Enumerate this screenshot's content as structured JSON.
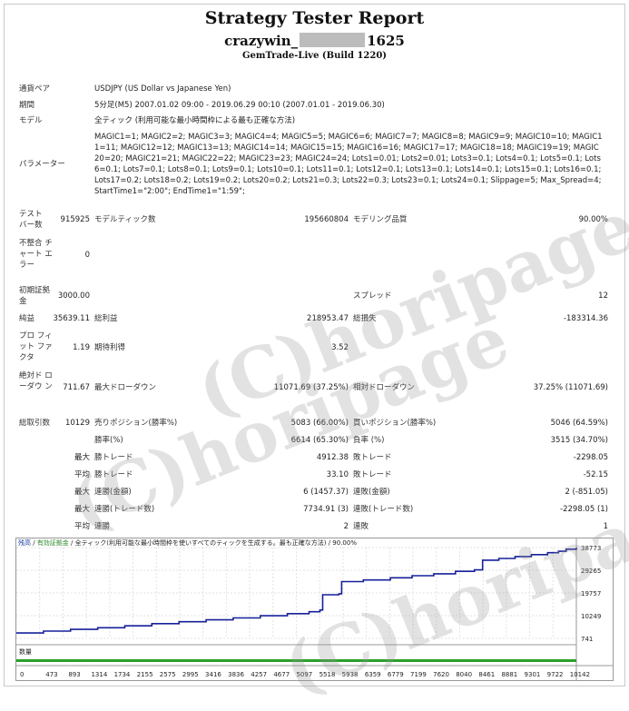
{
  "title": "Strategy Tester Report",
  "name_prefix": "crazywin_",
  "name_suffix": "1625",
  "build": "GemTrade-Live (Build 1220)",
  "rows": {
    "pair_label": "通貨ペア",
    "pair_value": "USDJPY (US Dollar vs Japanese Yen)",
    "period_label": "期間",
    "period_value": "5分足(M5) 2007.01.02 09:00 - 2019.06.29 00:10 (2007.01.01 - 2019.06.30)",
    "model_label": "モデル",
    "model_value": "全ティック (利用可能な最小時間枠による最も正確な方法)",
    "params_label": "パラメーター",
    "params_value": "MAGIC1=1; MAGIC2=2; MAGIC3=3; MAGIC4=4; MAGIC5=5; MAGIC6=6; MAGIC7=7; MAGIC8=8; MAGIC9=9; MAGIC10=10; MAGIC11=11; MAGIC12=12; MAGIC13=13; MAGIC14=14; MAGIC15=15; MAGIC16=16; MAGIC17=17; MAGIC18=18; MAGIC19=19; MAGIC20=20; MAGIC21=21; MAGIC22=22; MAGIC23=23; MAGIC24=24; Lots1=0.01; Lots2=0.01; Lots3=0.1; Lots4=0.1; Lots5=0.1; Lots6=0.1; Lots7=0.1; Lots8=0.1; Lots9=0.1; Lots10=0.1; Lots11=0.1; Lots12=0.1; Lots13=0.1; Lots14=0.1; Lots15=0.1; Lots16=0.1; Lots17=0.2; Lots18=0.2; Lots19=0.2; Lots20=0.2; Lots21=0.3; Lots22=0.3; Lots23=0.1; Lots24=0.1; Slippage=5; Max_Spread=4; StartTime1=\"2:00\"; EndTime1=\"1:59\";",
    "bars_label": "テスト バー数",
    "bars_value": "915925",
    "ticks_label": "モデルティック数",
    "ticks_value": "195660804",
    "quality_label": "モデリング品質",
    "quality_value": "90.00%",
    "mismatch_label": "不整合 チャート エラー",
    "mismatch_value": "0",
    "deposit_label": "初期証拠 金",
    "deposit_value": "3000.00",
    "spread_label": "スプレッド",
    "spread_value": "12",
    "netprofit_label": "純益",
    "netprofit_value": "35639.11",
    "grossprofit_label": "総利益",
    "grossprofit_value": "218953.47",
    "grossloss_label": "総損失",
    "grossloss_value": "-183314.36",
    "pf_label": "プロ フィット ファクタ",
    "pf_value": "1.19",
    "expected_label": "期待利得",
    "expected_value": "3.52",
    "absdd_label": "絶対ド ローダウ ン",
    "absdd_value": "711.67",
    "maxdd_label": "最大ドローダウン",
    "maxdd_value": "11071.69 (37.25%)",
    "reldd_label": "相対ドローダウン",
    "reldd_value": "37.25% (11071.69)",
    "trades_label": "総取引数",
    "trades_value": "10129",
    "short_label": "売りポジション(勝率%)",
    "short_value": "5083 (66.00%)",
    "long_label": "買いポジション(勝率%)",
    "long_value": "5046 (64.59%)",
    "win_label": "勝率(%)",
    "win_value": "6614 (65.30%)",
    "loss_label": "負率 (%)",
    "loss_value": "3515 (34.70%)",
    "max_label": "最大",
    "max_win_label": "勝トレード",
    "max_win_value": "4912.38",
    "max_loss_label": "敗トレード",
    "max_loss_value": "-2298.05",
    "avg_label": "平均",
    "avg_win_label": "勝トレード",
    "avg_win_value": "33.10",
    "avg_loss_label": "敗トレード",
    "avg_loss_value": "-52.15",
    "max2_label": "最大",
    "consec_wins_label": "連勝(金額)",
    "consec_wins_value": "6 (1457.37)",
    "consec_losses_label": "連敗(金額)",
    "consec_losses_value": "2 (-851.05)",
    "max3_label": "最大",
    "consec_profit_label": "連勝(トレード数)",
    "consec_profit_value": "7734.91 (3)",
    "consec_loss_label": "連敗(トレード数)",
    "consec_loss_value": "-2298.05 (1)",
    "avg2_label": "平均",
    "avg_consec_win_label": "連勝",
    "avg_consec_win_value": "2",
    "avg_consec_loss_label": "連敗",
    "avg_consec_loss_value": "1"
  },
  "watermark": "(C)horipage",
  "chart_legend": {
    "balance": "残高",
    "equity": "有効証拠金",
    "rest": "/ 全ティック(利用可能な最小時間枠を使いすべてのティックを生成する。最も正確な方法) / 90.00%",
    "volume": "数量"
  },
  "chart_data": {
    "type": "line",
    "y_ticks": [
      "38773",
      "29265",
      "19757",
      "10249",
      "741"
    ],
    "x_ticks": [
      "0",
      "473",
      "893",
      "1314",
      "1734",
      "2155",
      "2575",
      "2995",
      "3416",
      "3836",
      "4257",
      "4677",
      "5097",
      "5518",
      "5938",
      "6359",
      "6779",
      "7199",
      "7620",
      "8040",
      "8461",
      "8881",
      "9301",
      "9722",
      "10142"
    ],
    "ylim": [
      741,
      38773
    ],
    "xlim": [
      0,
      10330
    ],
    "series": [
      {
        "x": [
          0,
          500,
          1000,
          1500,
          2000,
          2500,
          3000,
          3500,
          4000,
          4500,
          5000,
          5400,
          5600,
          5650,
          5950,
          6000,
          6400,
          6900,
          7300,
          7700,
          8100,
          8450,
          8600,
          8900,
          9200,
          9500,
          9800,
          10000,
          10142,
          10330
        ],
        "values": [
          3000,
          3800,
          4500,
          5200,
          6000,
          6900,
          7700,
          8500,
          9300,
          10200,
          11100,
          11900,
          12600,
          19000,
          19400,
          24500,
          25200,
          26100,
          27000,
          27800,
          28800,
          29400,
          33500,
          34200,
          35000,
          35800,
          36600,
          37200,
          38100,
          38773
        ]
      }
    ]
  }
}
